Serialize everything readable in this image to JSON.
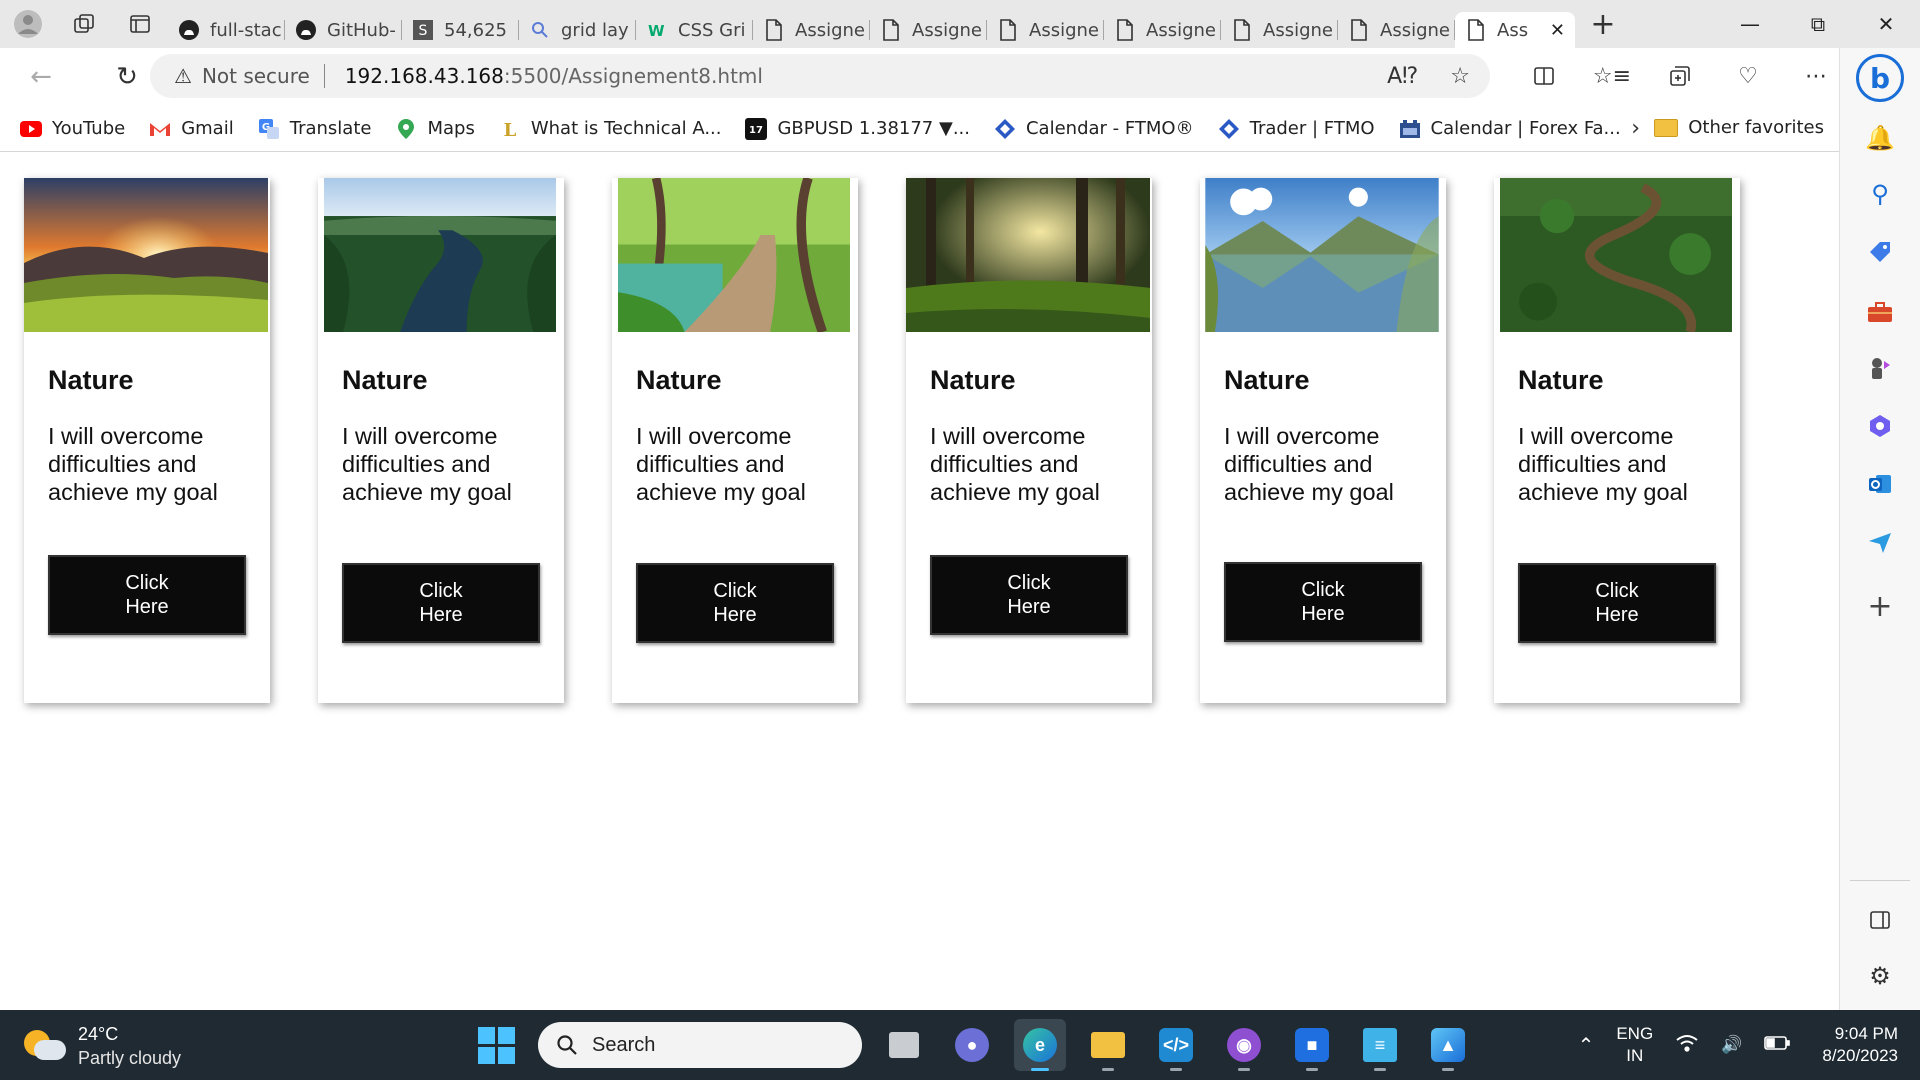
{
  "browser": {
    "tabs": [
      {
        "label": "full-stac",
        "icon": "github-icon"
      },
      {
        "label": "GitHub-",
        "icon": "github-icon"
      },
      {
        "label": "54,625",
        "icon": "s-logo-icon"
      },
      {
        "label": "grid lay",
        "icon": "search-icon"
      },
      {
        "label": "CSS Gri",
        "icon": "w3schools-icon"
      },
      {
        "label": "Assigne",
        "icon": "page-icon"
      },
      {
        "label": "Assigne",
        "icon": "page-icon"
      },
      {
        "label": "Assigne",
        "icon": "page-icon"
      },
      {
        "label": "Assigne",
        "icon": "page-icon"
      },
      {
        "label": "Assigne",
        "icon": "page-icon"
      },
      {
        "label": "Assigne",
        "icon": "page-icon"
      },
      {
        "label": "Ass",
        "icon": "page-icon",
        "active": true
      }
    ],
    "address": {
      "security_text": "Not secure",
      "host": "192.168.43.168",
      "rest": ":5500/Assignement8.html"
    },
    "bookmarks": [
      {
        "label": "YouTube",
        "icon": "youtube-icon",
        "color": "#ff0000"
      },
      {
        "label": "Gmail",
        "icon": "gmail-icon",
        "color": "#ea4335"
      },
      {
        "label": "Translate",
        "icon": "translate-icon",
        "color": "#4285f4"
      },
      {
        "label": "Maps",
        "icon": "maps-icon",
        "color": "#34a853"
      },
      {
        "label": "What is Technical A...",
        "icon": "bookmark-icon",
        "color": "#c9a227"
      },
      {
        "label": "GBPUSD 1.38177 ▼...",
        "icon": "tradingview-icon",
        "color": "#111111"
      },
      {
        "label": "Calendar - FTMO®",
        "icon": "ftmo-icon",
        "color": "#2b59c3"
      },
      {
        "label": "Trader | FTMO",
        "icon": "ftmo-icon",
        "color": "#2b59c3"
      },
      {
        "label": "Calendar | Forex Fa...",
        "icon": "forexfactory-icon",
        "color": "#2d4f8f"
      }
    ],
    "other_favorites": "Other favorites"
  },
  "cards": [
    {
      "title": "Nature",
      "text": "I will overcome difficulties and achieve my goal",
      "button": "Click Here",
      "scene": "sunset-meadow"
    },
    {
      "title": "Nature",
      "text": "I will overcome difficulties and achieve my goal",
      "button": "Click Here",
      "scene": "forest-river"
    },
    {
      "title": "Nature",
      "text": "I will overcome difficulties and achieve my goal",
      "button": "Click Here",
      "scene": "boardwalk-path"
    },
    {
      "title": "Nature",
      "text": "I will overcome difficulties and achieve my goal",
      "button": "Click Here",
      "scene": "sunlit-forest"
    },
    {
      "title": "Nature",
      "text": "I will overcome difficulties and achieve my goal",
      "button": "Click Here",
      "scene": "mountain-lake"
    },
    {
      "title": "Nature",
      "text": "I will overcome difficulties and achieve my goal",
      "button": "Click Here",
      "scene": "winding-river"
    }
  ],
  "taskbar": {
    "weather": {
      "temp": "24°C",
      "desc": "Partly cloudy"
    },
    "search_placeholder": "Search",
    "language": {
      "line1": "ENG",
      "line2": "IN"
    },
    "time": "9:04 PM",
    "date": "8/20/2023"
  }
}
